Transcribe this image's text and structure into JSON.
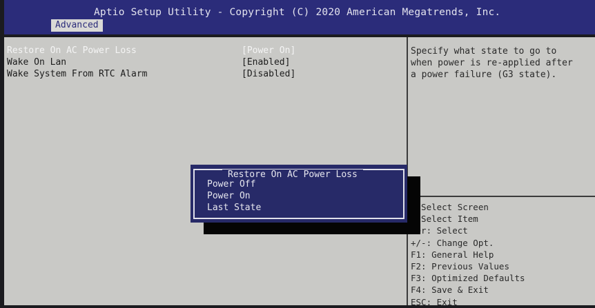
{
  "header": {
    "title": "Aptio Setup Utility - Copyright (C) 2020 American Megatrends, Inc.",
    "tab": "Advanced"
  },
  "settings": [
    {
      "label": "Restore On AC Power Loss",
      "value": "[Power On]"
    },
    {
      "label": "Wake On Lan",
      "value": "[Enabled]"
    },
    {
      "label": "Wake System From RTC Alarm",
      "value": "[Disabled]"
    }
  ],
  "help": [
    "Specify what state to go to",
    "when power is re-applied after",
    "a power failure (G3 state)."
  ],
  "keys": [
    ": Select Screen",
    ": Select Item",
    "ter: Select",
    "+/-: Change Opt.",
    "F1: General Help",
    "F2: Previous Values",
    "F3: Optimized Defaults",
    "F4: Save & Exit",
    "ESC: Exit"
  ],
  "popup": {
    "title": "Restore On AC Power Loss",
    "options": [
      "Power Off",
      "Power On",
      "Last State"
    ]
  },
  "colors": {
    "header_bg": "#2b2c7a",
    "panel_bg": "#c9c9c6",
    "popup_bg": "#272a68",
    "selected_text": "#f4f4f4"
  }
}
